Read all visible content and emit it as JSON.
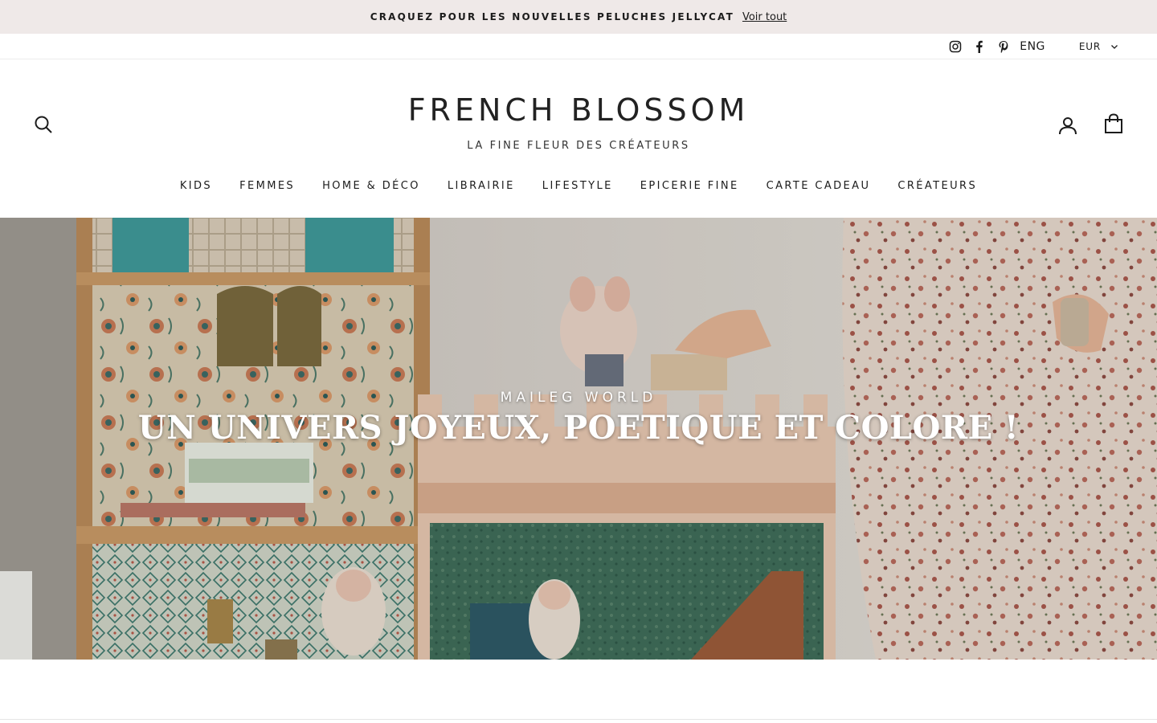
{
  "announcement": {
    "message": "CRAQUEZ POUR LES NOUVELLES PELUCHES JELLYCAT",
    "link_label": "Voir tout"
  },
  "utility_bar": {
    "social_icons": [
      "instagram-icon",
      "facebook-icon",
      "pinterest-icon"
    ],
    "language": "ENG",
    "currency": "EUR"
  },
  "header": {
    "brand": "FRENCH BLOSSOM",
    "tagline": "LA FINE FLEUR DES CRÉATEURS",
    "icons": [
      "search-icon",
      "user-icon",
      "bag-icon"
    ]
  },
  "nav": {
    "items": [
      "KIDS",
      "FEMMES",
      "HOME & DÉCO",
      "LIBRAIRIE",
      "LIFESTYLE",
      "EPICERIE FINE",
      "CARTE CADEAU",
      "CRÉATEURS"
    ]
  },
  "hero": {
    "eyebrow": "MAILEG WORLD",
    "headline": "UN UNIVERS JOYEUX, POETIQUE ET COLORE !"
  },
  "colors": {
    "announcement_bg": "#efe9e8",
    "text": "#1c1c1c",
    "hero_text": "#ffffff"
  }
}
